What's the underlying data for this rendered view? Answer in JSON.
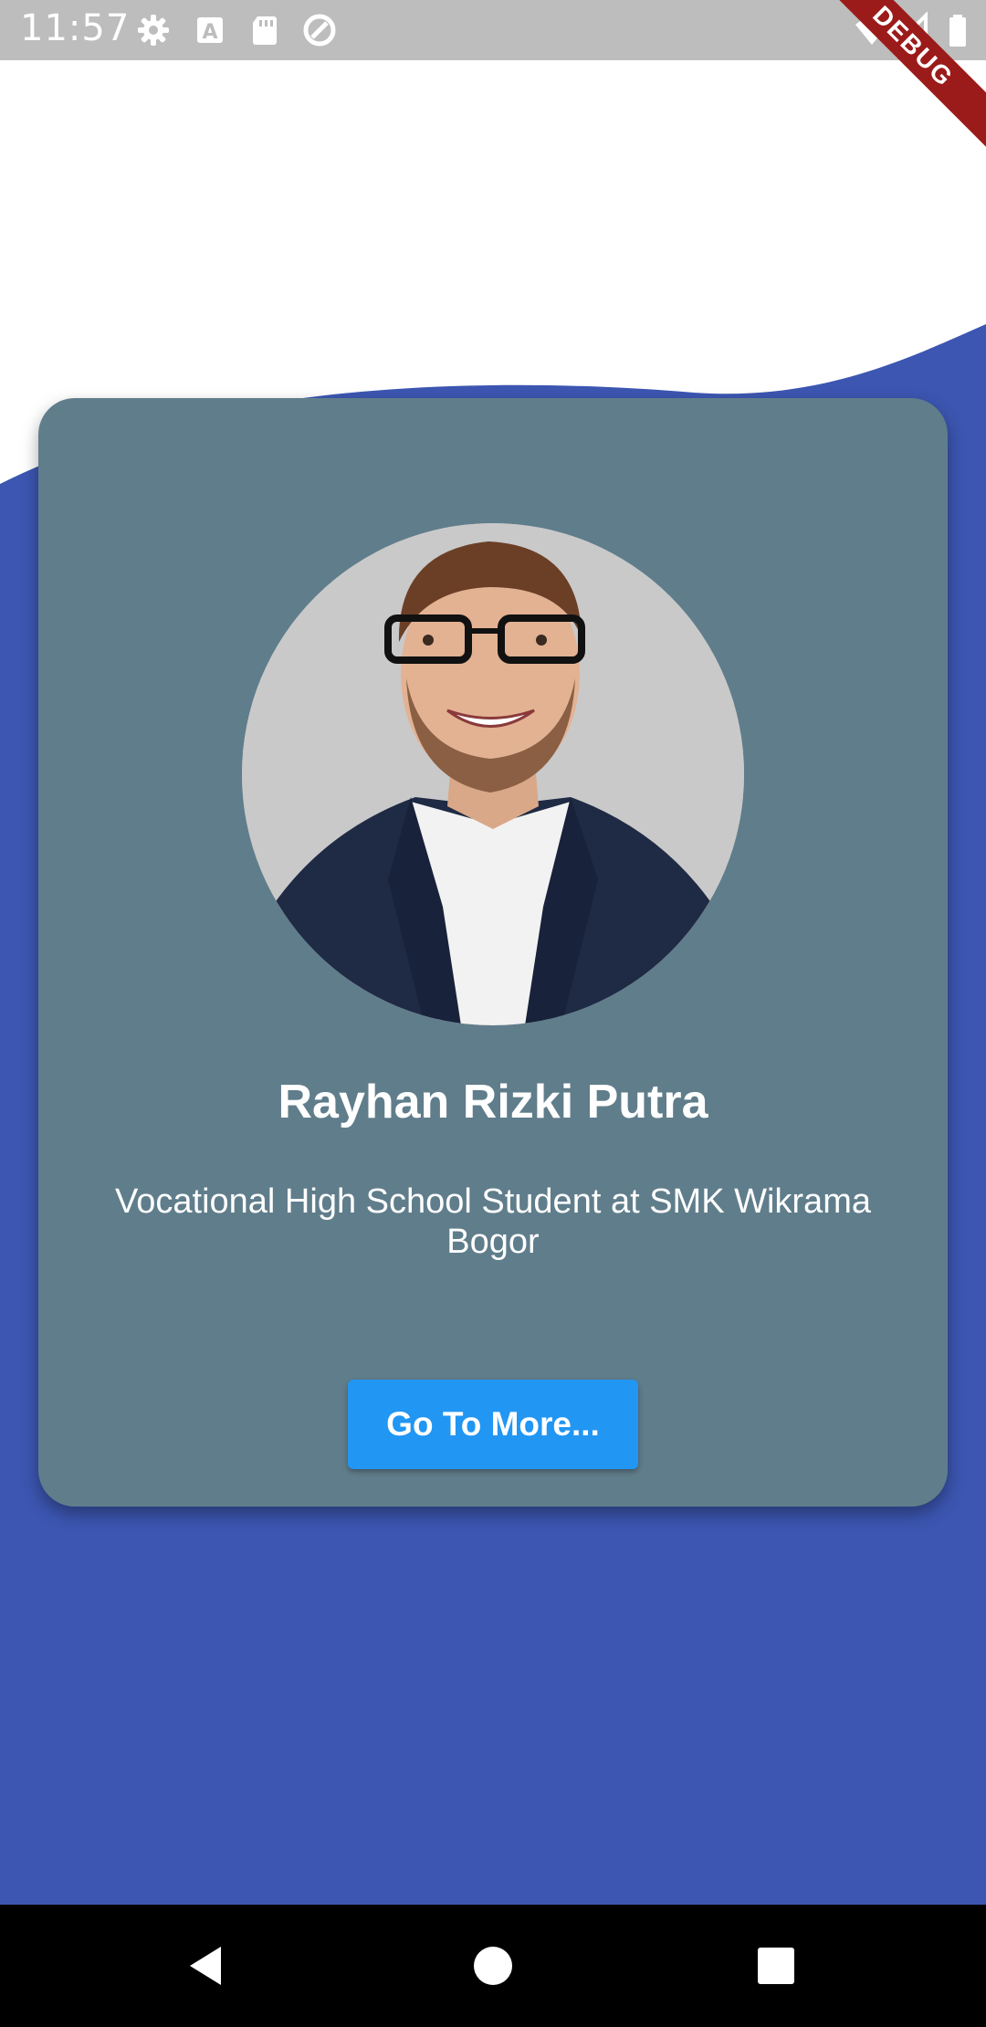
{
  "status_bar": {
    "time": "11:57",
    "icons": [
      "settings-icon",
      "text-a-icon",
      "sd-card-icon",
      "sync-icon",
      "wifi-icon",
      "signal-icon",
      "battery-icon"
    ]
  },
  "debug_banner": "DEBUG",
  "profile": {
    "name": "Rayhan Rizki Putra",
    "subtitle": "Vocational High School Student at SMK Wikrama Bogor",
    "button_label": "Go To More..."
  },
  "colors": {
    "background_wave": "#3c56b1",
    "card": "#607d8b",
    "button": "#2196f3",
    "status_bar": "#bdbdbd",
    "debug_banner": "#9b1b1b"
  },
  "nav_bar": {
    "icons": [
      "back-icon",
      "home-icon",
      "recents-icon"
    ]
  }
}
